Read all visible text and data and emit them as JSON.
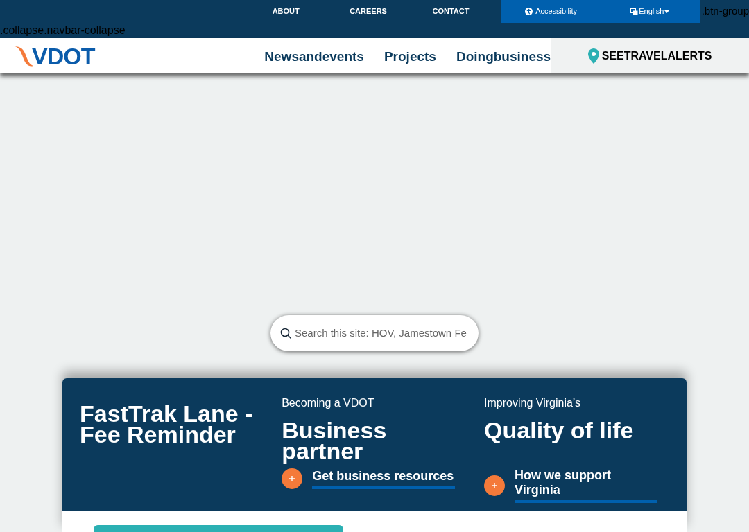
{
  "utility_bar": {
    "links": [
      "ABOUT",
      "CAREERS",
      "CONTACT"
    ],
    "accessibility_button": "Accessibility",
    "language_button": "English",
    "stray_text": ".btn-group"
  },
  "stray_text": ".collapse.navbar-collapse",
  "navbar": {
    "logo": "VDOT",
    "items": [
      "Newsandevents",
      "Projects",
      "Doingbusiness"
    ],
    "travel_alerts": "SEETRAVELALERTS"
  },
  "search": {
    "placeholder": "Search this site: HOV, Jamestown Fe"
  },
  "feature_band": {
    "columns": [
      {
        "kind": "title",
        "title": "FastTrak Lane - Fee Reminder"
      },
      {
        "kind": "promo",
        "eyebrow": "Becoming a VDOT",
        "heading": "Business partner",
        "link": "Get business resources"
      },
      {
        "kind": "promo",
        "eyebrow": "Improving Virginia’s",
        "heading": "Quality of life",
        "link": "How we support Virginia"
      }
    ]
  }
}
